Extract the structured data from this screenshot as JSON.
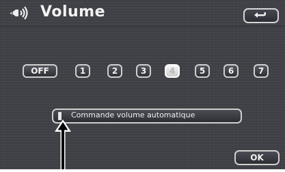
{
  "header": {
    "title": "Volume",
    "title_icon": "speaker-volume-icon",
    "back_icon": "return-arrow-icon"
  },
  "volume_levels": {
    "off_label": "OFF",
    "levels": [
      "1",
      "2",
      "3",
      "4",
      "5",
      "6",
      "7"
    ],
    "selected": "4"
  },
  "auto_volume": {
    "label": "Commande volume automatique",
    "indicator_on": false
  },
  "footer": {
    "ok_label": "OK"
  },
  "colors": {
    "background": "#404147",
    "button_border": "#d0d0d0",
    "selected_button": "#e6e6e6",
    "text": "#f2f2f2"
  },
  "annotation": {
    "icon": "callout-arrow-icon"
  }
}
